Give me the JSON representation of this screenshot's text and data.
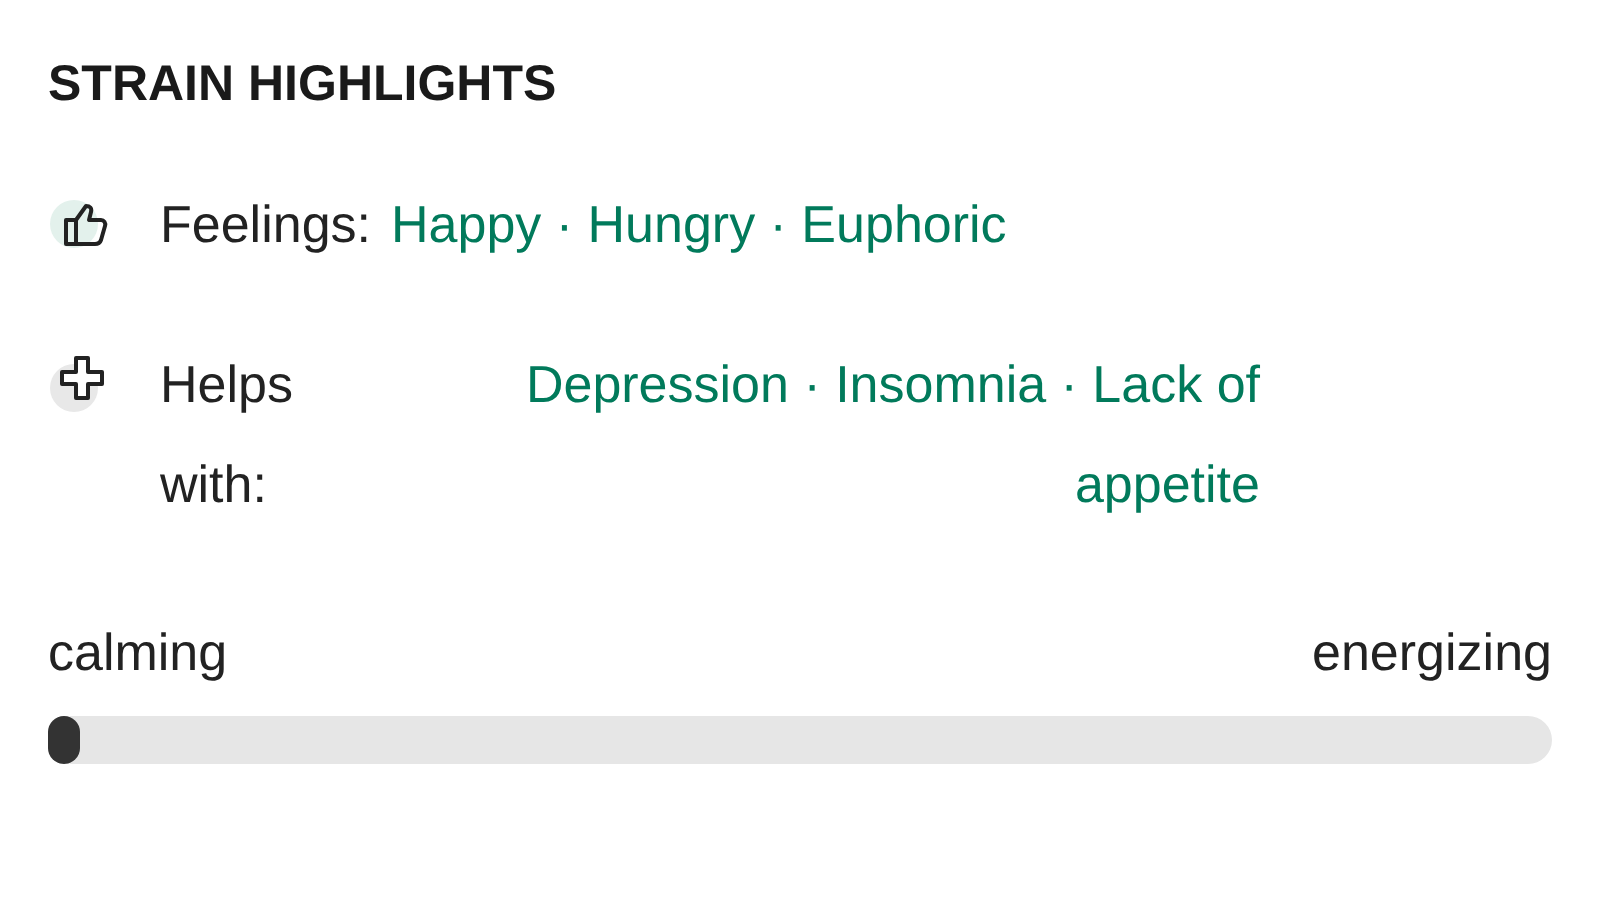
{
  "title": "STRAIN HIGHLIGHTS",
  "highlights": [
    {
      "kind": "feelings",
      "label": "Feelings:",
      "value": "Happy · Hungry · Euphoric"
    },
    {
      "kind": "helps",
      "label": "Helps with:",
      "value": "Depression · Insomnia · Lack of appetite"
    }
  ],
  "scale": {
    "min_label": "calming",
    "max_label": "energizing",
    "level": 0
  }
}
